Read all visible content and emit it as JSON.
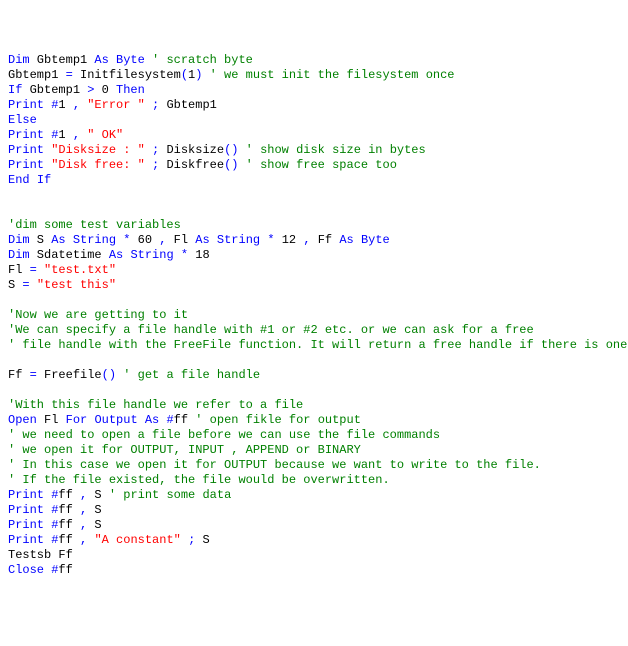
{
  "code": {
    "tokens": [
      [
        [
          "kw",
          "Dim"
        ],
        [
          "tx",
          " Gbtemp1 "
        ],
        [
          "kw",
          "As"
        ],
        [
          "tx",
          " "
        ],
        [
          "kw",
          "Byte"
        ],
        [
          "tx",
          " "
        ],
        [
          "cm",
          "' scratch byte"
        ]
      ],
      [
        [
          "tx",
          "Gbtemp1 "
        ],
        [
          "kw",
          "="
        ],
        [
          "tx",
          " Initfilesystem"
        ],
        [
          "kw",
          "("
        ],
        [
          "tx",
          "1"
        ],
        [
          "kw",
          ")"
        ],
        [
          "tx",
          " "
        ],
        [
          "cm",
          "' we must init the filesystem once"
        ]
      ],
      [
        [
          "kw",
          "If"
        ],
        [
          "tx",
          " Gbtemp1 "
        ],
        [
          "kw",
          ">"
        ],
        [
          "tx",
          " 0 "
        ],
        [
          "kw",
          "Then"
        ]
      ],
      [
        [
          "kw",
          "Print"
        ],
        [
          "tx",
          " "
        ],
        [
          "kw",
          "#"
        ],
        [
          "tx",
          "1 "
        ],
        [
          "kw",
          ","
        ],
        [
          "tx",
          " "
        ],
        [
          "st",
          "\"Error \""
        ],
        [
          "tx",
          " "
        ],
        [
          "kw",
          ";"
        ],
        [
          "tx",
          " Gbtemp1"
        ]
      ],
      [
        [
          "kw",
          "Else"
        ]
      ],
      [
        [
          "kw",
          "Print"
        ],
        [
          "tx",
          " "
        ],
        [
          "kw",
          "#"
        ],
        [
          "tx",
          "1 "
        ],
        [
          "kw",
          ","
        ],
        [
          "tx",
          " "
        ],
        [
          "st",
          "\" OK\""
        ]
      ],
      [
        [
          "kw",
          "Print"
        ],
        [
          "tx",
          " "
        ],
        [
          "st",
          "\"Disksize : \""
        ],
        [
          "tx",
          " "
        ],
        [
          "kw",
          ";"
        ],
        [
          "tx",
          " Disksize"
        ],
        [
          "kw",
          "()"
        ],
        [
          "tx",
          " "
        ],
        [
          "cm",
          "' show disk size in bytes"
        ]
      ],
      [
        [
          "kw",
          "Print"
        ],
        [
          "tx",
          " "
        ],
        [
          "st",
          "\"Disk free: \""
        ],
        [
          "tx",
          " "
        ],
        [
          "kw",
          ";"
        ],
        [
          "tx",
          " Diskfree"
        ],
        [
          "kw",
          "()"
        ],
        [
          "tx",
          " "
        ],
        [
          "cm",
          "' show free space too"
        ]
      ],
      [
        [
          "kw",
          "End"
        ],
        [
          "tx",
          " "
        ],
        [
          "kw",
          "If"
        ]
      ],
      [
        [
          "tx",
          ""
        ]
      ],
      [
        [
          "tx",
          ""
        ]
      ],
      [
        [
          "cm",
          "'dim some test variables"
        ]
      ],
      [
        [
          "kw",
          "Dim"
        ],
        [
          "tx",
          " S "
        ],
        [
          "kw",
          "As"
        ],
        [
          "tx",
          " "
        ],
        [
          "kw",
          "String"
        ],
        [
          "tx",
          " "
        ],
        [
          "kw",
          "*"
        ],
        [
          "tx",
          " 60 "
        ],
        [
          "kw",
          ","
        ],
        [
          "tx",
          " Fl "
        ],
        [
          "kw",
          "As"
        ],
        [
          "tx",
          " "
        ],
        [
          "kw",
          "String"
        ],
        [
          "tx",
          " "
        ],
        [
          "kw",
          "*"
        ],
        [
          "tx",
          " 12 "
        ],
        [
          "kw",
          ","
        ],
        [
          "tx",
          " Ff "
        ],
        [
          "kw",
          "As"
        ],
        [
          "tx",
          " "
        ],
        [
          "kw",
          "Byte"
        ]
      ],
      [
        [
          "kw",
          "Dim"
        ],
        [
          "tx",
          " Sdatetime "
        ],
        [
          "kw",
          "As"
        ],
        [
          "tx",
          " "
        ],
        [
          "kw",
          "String"
        ],
        [
          "tx",
          " "
        ],
        [
          "kw",
          "*"
        ],
        [
          "tx",
          " 18"
        ]
      ],
      [
        [
          "tx",
          "Fl "
        ],
        [
          "kw",
          "="
        ],
        [
          "tx",
          " "
        ],
        [
          "st",
          "\"test.txt\""
        ]
      ],
      [
        [
          "tx",
          "S "
        ],
        [
          "kw",
          "="
        ],
        [
          "tx",
          " "
        ],
        [
          "st",
          "\"test this\""
        ]
      ],
      [
        [
          "tx",
          ""
        ]
      ],
      [
        [
          "cm",
          "'Now we are getting to it"
        ]
      ],
      [
        [
          "cm",
          "'We can specify a file handle with #1 or #2 etc. or we can ask for a free"
        ]
      ],
      [
        [
          "cm",
          "' file handle with the FreeFile function. It will return a free handle if there is one."
        ]
      ],
      [
        [
          "tx",
          ""
        ]
      ],
      [
        [
          "tx",
          "Ff "
        ],
        [
          "kw",
          "="
        ],
        [
          "tx",
          " Freefile"
        ],
        [
          "kw",
          "()"
        ],
        [
          "tx",
          " "
        ],
        [
          "cm",
          "' get a file handle"
        ]
      ],
      [
        [
          "tx",
          ""
        ]
      ],
      [
        [
          "cm",
          "'With this file handle we refer to a file"
        ]
      ],
      [
        [
          "kw",
          "Open"
        ],
        [
          "tx",
          " Fl "
        ],
        [
          "kw",
          "For"
        ],
        [
          "tx",
          " "
        ],
        [
          "kw",
          "Output"
        ],
        [
          "tx",
          " "
        ],
        [
          "kw",
          "As"
        ],
        [
          "tx",
          " "
        ],
        [
          "kw",
          "#"
        ],
        [
          "tx",
          "ff "
        ],
        [
          "cm",
          "' open fikle for output"
        ]
      ],
      [
        [
          "cm",
          "' we need to open a file before we can use the file commands"
        ]
      ],
      [
        [
          "cm",
          "' we open it for OUTPUT, INPUT , APPEND or BINARY"
        ]
      ],
      [
        [
          "cm",
          "' In this case we open it for OUTPUT because we want to write to the file."
        ]
      ],
      [
        [
          "cm",
          "' If the file existed, the file would be overwritten."
        ]
      ],
      [
        [
          "kw",
          "Print"
        ],
        [
          "tx",
          " "
        ],
        [
          "kw",
          "#"
        ],
        [
          "tx",
          "ff "
        ],
        [
          "kw",
          ","
        ],
        [
          "tx",
          " S "
        ],
        [
          "cm",
          "' print some data"
        ]
      ],
      [
        [
          "kw",
          "Print"
        ],
        [
          "tx",
          " "
        ],
        [
          "kw",
          "#"
        ],
        [
          "tx",
          "ff "
        ],
        [
          "kw",
          ","
        ],
        [
          "tx",
          " S"
        ]
      ],
      [
        [
          "kw",
          "Print"
        ],
        [
          "tx",
          " "
        ],
        [
          "kw",
          "#"
        ],
        [
          "tx",
          "ff "
        ],
        [
          "kw",
          ","
        ],
        [
          "tx",
          " S"
        ]
      ],
      [
        [
          "kw",
          "Print"
        ],
        [
          "tx",
          " "
        ],
        [
          "kw",
          "#"
        ],
        [
          "tx",
          "ff "
        ],
        [
          "kw",
          ","
        ],
        [
          "tx",
          " "
        ],
        [
          "st",
          "\"A constant\""
        ],
        [
          "tx",
          " "
        ],
        [
          "kw",
          ";"
        ],
        [
          "tx",
          " S"
        ]
      ],
      [
        [
          "tx",
          "Testsb Ff"
        ]
      ],
      [
        [
          "kw",
          "Close"
        ],
        [
          "tx",
          " "
        ],
        [
          "kw",
          "#"
        ],
        [
          "tx",
          "ff"
        ]
      ]
    ]
  }
}
